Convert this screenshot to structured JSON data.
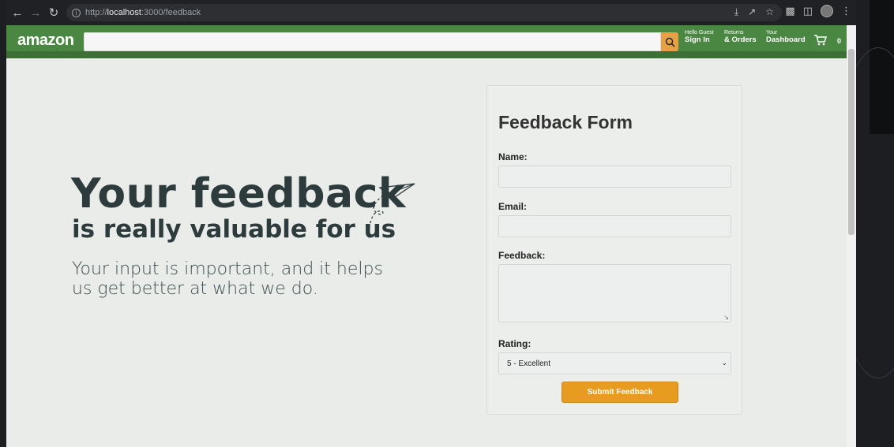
{
  "browser": {
    "url_scheme": "http://",
    "url_host": "localhost",
    "url_path": ":3000/feedback"
  },
  "navbar": {
    "logo": "amazon",
    "signin_small": "Hello Guest",
    "signin_big": "Sign In",
    "returns_small": "Returns",
    "returns_big": "& Orders",
    "dashboard_small": "Your",
    "dashboard_big": "Dashboard",
    "cart_count": "0"
  },
  "hero": {
    "title": "Your feedback",
    "subtitle": "is really valuable for us",
    "text": "Your input is important, and it helps us get better at what we do."
  },
  "form": {
    "title": "Feedback Form",
    "name_label": "Name:",
    "email_label": "Email:",
    "feedback_label": "Feedback:",
    "rating_label": "Rating:",
    "rating_value": "5 - Excellent",
    "submit_label": "Submit Feedback"
  },
  "colors": {
    "navbar": "#4a8742",
    "search_button": "#e7a144",
    "submit_button": "#e79b1f",
    "hero_text": "#2d3b3d"
  }
}
